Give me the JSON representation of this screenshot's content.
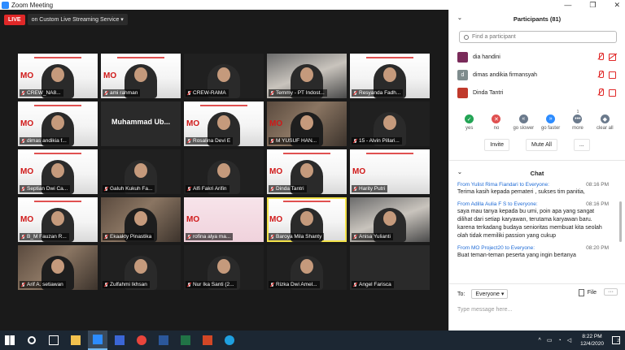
{
  "window": {
    "title": "Zoom Meeting",
    "controls": [
      "—",
      "❐",
      "✕"
    ]
  },
  "live": {
    "badge": "LIVE",
    "service": "on Custom Live Streaming Service ▾"
  },
  "tiles": [
    {
      "name": "CREW_NA8...",
      "style": "slide",
      "mo": true,
      "person": true
    },
    {
      "name": "ami rahman",
      "style": "slide",
      "mo": true,
      "person": true
    },
    {
      "name": "CREW-RAMA",
      "style": "dark",
      "person": true
    },
    {
      "name": "Temmy - PT Indost...",
      "style": "cam2",
      "person": true
    },
    {
      "name": "Resyanda Fadh...",
      "style": "slide",
      "person": true
    },
    {
      "name": "dimas andikia f...",
      "style": "slide",
      "mo": true,
      "person": true
    },
    {
      "name": "",
      "style": "blank",
      "center": "Muhammad Ub..."
    },
    {
      "name": "Rosalina Devi E",
      "style": "slide",
      "mo": true,
      "person": true
    },
    {
      "name": "M YUSUF HAN...",
      "style": "cam",
      "mo": true,
      "person": true
    },
    {
      "name": "15 - Alvin Pillari...",
      "style": "dark",
      "person": true
    },
    {
      "name": "Septian Dwi Ca...",
      "style": "slide",
      "mo": true,
      "person": true
    },
    {
      "name": "Galuh Kukuh Fa...",
      "style": "dark",
      "person": true
    },
    {
      "name": "Alfi Fakri Arifin",
      "style": "dark",
      "person": true
    },
    {
      "name": "Dinda Tantri",
      "style": "slide",
      "mo": true,
      "person": true
    },
    {
      "name": "Harity Putri",
      "style": "slide",
      "mo": true
    },
    {
      "name": "B_M Fauzan R...",
      "style": "slide",
      "mo": true,
      "person": true
    },
    {
      "name": "Ekaakty Pinastika",
      "style": "cam",
      "person": true
    },
    {
      "name": "rofina alya ma...",
      "style": "pink",
      "mo": true
    },
    {
      "name": "Baroya Mila Shanty",
      "style": "slide",
      "mo": true,
      "person": true,
      "active": true
    },
    {
      "name": "Anisa Yulianti",
      "style": "cam2",
      "person": true
    },
    {
      "name": "Arif A. setiawan",
      "style": "cam",
      "person": true
    },
    {
      "name": "Zulfahmi Ikhsan",
      "style": "dark",
      "person": true
    },
    {
      "name": "Nur Ika Santi (2...",
      "style": "dark",
      "person": true
    },
    {
      "name": "Rizka Dwi Amel...",
      "style": "dark",
      "person": true
    },
    {
      "name": "Angel Farisca",
      "style": "blank"
    }
  ],
  "participants": {
    "header": "Participants (81)",
    "search_placeholder": "Find a participant",
    "list": [
      {
        "name": "dia handini",
        "avatar": "",
        "avatar_color": "#7a2b5a",
        "cam_off": true
      },
      {
        "name": "dimas andikia firmansyah",
        "avatar": "d",
        "avatar_color": "#7f8c8d",
        "cam_off": false
      },
      {
        "name": "Dinda Tantri",
        "avatar": "",
        "avatar_color": "#c0392b",
        "cam_off": false
      }
    ],
    "reactions": [
      {
        "label": "yes",
        "symbol": "✓",
        "color": "#23a455",
        "count": ""
      },
      {
        "label": "no",
        "symbol": "✕",
        "color": "#e05050",
        "count": ""
      },
      {
        "label": "go slower",
        "symbol": "«",
        "color": "#6b7a8c",
        "count": ""
      },
      {
        "label": "go faster",
        "symbol": "»",
        "color": "#2d8cff",
        "count": ""
      },
      {
        "label": "more",
        "symbol": "•••",
        "color": "#6b7a8c",
        "count": "1"
      },
      {
        "label": "clear all",
        "symbol": "◆",
        "color": "#6b7a8c",
        "count": ""
      }
    ],
    "buttons": {
      "invite": "Invite",
      "mute_all": "Mute All",
      "more": "..."
    }
  },
  "chat": {
    "header": "Chat",
    "messages": [
      {
        "from": "From Yulist Rima Fiandari to Everyone:",
        "time": "08:16 PM",
        "text": "Terima kasih kepada pemateri , sukses  tim panitia,"
      },
      {
        "from": "From Adilla Aulia F S to Everyone:",
        "time": "08:16 PM",
        "text": "saya mau tanya kepada bu umi, poin apa yang sangat dilihat dari setiap karyawan, terutama karyawan baru. karena terkadang budaya senioritas membuat kita seolah olah tidak memiliki passion yang cukup"
      },
      {
        "from": "From MO Project20 to Everyone:",
        "time": "08:20 PM",
        "text": "Buat teman-teman peserta yang ingin bertanya"
      }
    ],
    "to_label": "To:",
    "to_value": "Everyone ▾",
    "file_label": "File",
    "more_label": "···",
    "input_placeholder": "Type message here..."
  },
  "taskbar": {
    "apps": [
      {
        "name": "windows-start",
        "color": "#ffffff"
      },
      {
        "name": "search",
        "color": "#ffffff"
      },
      {
        "name": "task-view",
        "color": "#ffffff"
      },
      {
        "name": "file-explorer",
        "color": "#f2c14e"
      },
      {
        "name": "zoom",
        "color": "#2d8cff",
        "active": true
      },
      {
        "name": "pen-app",
        "color": "#3b66d6"
      },
      {
        "name": "chrome",
        "color": "#e8453c"
      },
      {
        "name": "word",
        "color": "#2b579a"
      },
      {
        "name": "excel",
        "color": "#217346"
      },
      {
        "name": "powerpoint",
        "color": "#d24726"
      },
      {
        "name": "edge",
        "color": "#1fa0e0"
      }
    ],
    "time": "8:22 PM",
    "date": "12/4/2020",
    "notifications": "2"
  }
}
